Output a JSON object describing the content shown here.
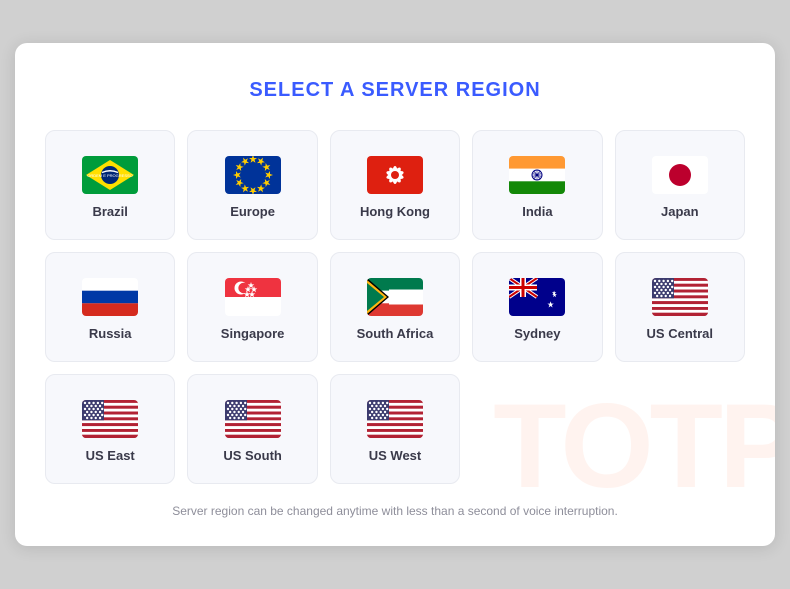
{
  "title": "SELECT A SERVER REGION",
  "regions_row1": [
    {
      "id": "brazil",
      "label": "Brazil",
      "flag_type": "brazil"
    },
    {
      "id": "europe",
      "label": "Europe",
      "flag_type": "europe"
    },
    {
      "id": "hongkong",
      "label": "Hong Kong",
      "flag_type": "hongkong"
    },
    {
      "id": "india",
      "label": "India",
      "flag_type": "india"
    },
    {
      "id": "japan",
      "label": "Japan",
      "flag_type": "japan"
    }
  ],
  "regions_row2": [
    {
      "id": "russia",
      "label": "Russia",
      "flag_type": "russia"
    },
    {
      "id": "singapore",
      "label": "Singapore",
      "flag_type": "singapore"
    },
    {
      "id": "southafrica",
      "label": "South Africa",
      "flag_type": "southafrica"
    },
    {
      "id": "sydney",
      "label": "Sydney",
      "flag_type": "sydney"
    },
    {
      "id": "uscentral",
      "label": "US Central",
      "flag_type": "us"
    }
  ],
  "regions_row3": [
    {
      "id": "useast",
      "label": "US East",
      "flag_type": "us"
    },
    {
      "id": "ussouth",
      "label": "US South",
      "flag_type": "us"
    },
    {
      "id": "uswest",
      "label": "US West",
      "flag_type": "us"
    }
  ],
  "footer": "Server region can be changed anytime with less than a second of voice interruption.",
  "watermark": "TOTP"
}
